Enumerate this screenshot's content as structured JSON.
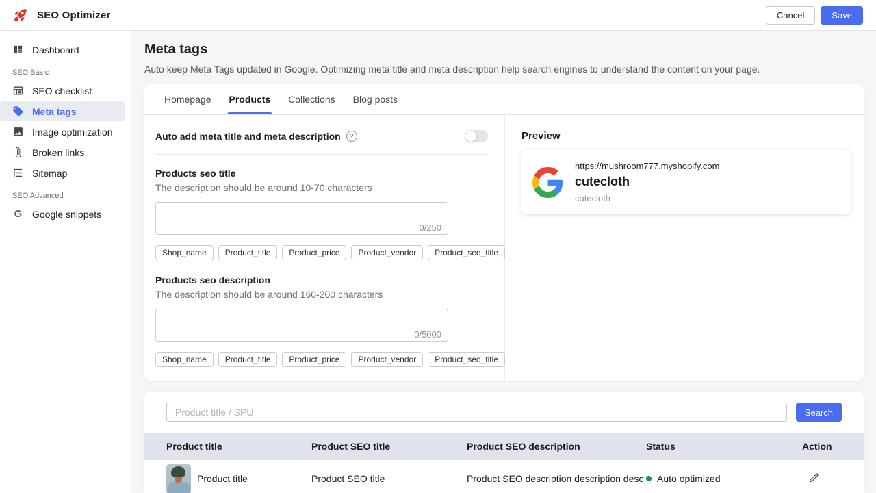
{
  "colors": {
    "accent": "#4a6cf0",
    "brand_red": "#d8352c",
    "status_green": "#0e9164",
    "table_header_bg": "#e0e3eb"
  },
  "topbar": {
    "app_name": "SEO Optimizer",
    "cancel_label": "Cancel",
    "save_label": "Save"
  },
  "sidebar": {
    "items": [
      {
        "label": "Dashboard",
        "icon": "dashboard-icon"
      },
      {
        "label": "SEO Basic",
        "type": "section"
      },
      {
        "label": "SEO checklist",
        "icon": "checklist-icon"
      },
      {
        "label": "Meta tags",
        "icon": "tag-icon",
        "active": true
      },
      {
        "label": "Image optimization",
        "icon": "image-icon"
      },
      {
        "label": "Broken links",
        "icon": "link-icon"
      },
      {
        "label": "Sitemap",
        "icon": "sitemap-icon"
      },
      {
        "label": "SEO Advanced",
        "type": "section"
      },
      {
        "label": "Google snippets",
        "icon": "google-g-icon"
      }
    ]
  },
  "page": {
    "title": "Meta tags",
    "subtitle": "Auto keep Meta Tags updated in Google. Optimizing meta title and meta description help search engines to understand the content on your page."
  },
  "tabs": [
    {
      "label": "Homepage"
    },
    {
      "label": "Products",
      "active": true
    },
    {
      "label": "Collections"
    },
    {
      "label": "Blog posts"
    }
  ],
  "form": {
    "auto_add_label": "Auto add meta title and meta description",
    "toggle_state": "off",
    "title_section": {
      "label": "Products seo title",
      "hint": "The description should be around 10-70 characters",
      "value": "",
      "counter": "0/250"
    },
    "description_section": {
      "label": "Products seo description",
      "hint": "The description should be around 160-200 characters",
      "value": "",
      "counter": "0/5000"
    },
    "variable_tags": [
      "Shop_name",
      "Product_title",
      "Product_price",
      "Product_vendor",
      "Product_seo_title"
    ]
  },
  "preview": {
    "heading": "Preview",
    "url": "https://mushroom777.myshopify.com",
    "title": "cutecloth",
    "description": "cutecloth"
  },
  "product_search": {
    "placeholder": "Product title / SPU",
    "button_label": "Search"
  },
  "table": {
    "headers": [
      "Product title",
      "Product SEO title",
      "Product SEO description",
      "Status",
      "Action"
    ],
    "rows": [
      {
        "title": "Product title",
        "seo_title": "Product SEO title",
        "seo_description": "Product SEO description description desc",
        "status": "Auto optimized"
      }
    ]
  }
}
